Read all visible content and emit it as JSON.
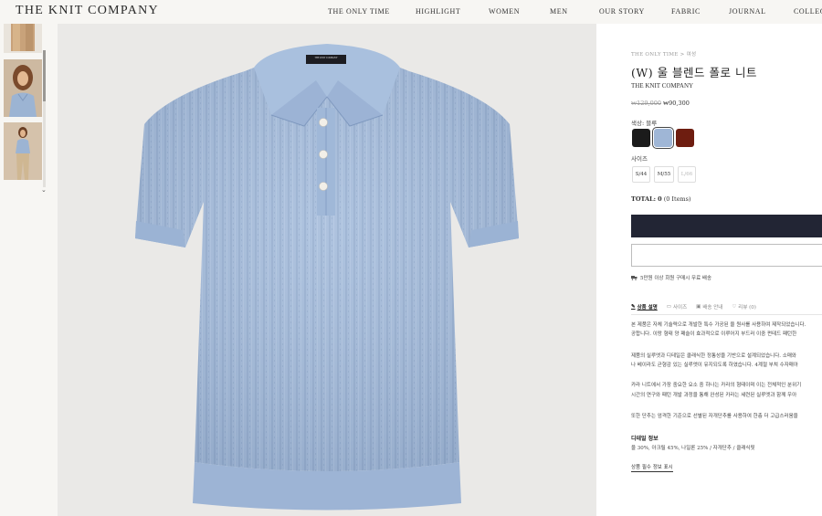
{
  "header": {
    "logo": "THE KNIT COMPANY",
    "nav": [
      "THE ONLY TIME",
      "HIGHLIGHT",
      "WOMEN",
      "MEN",
      "OUR STORY",
      "FABRIC",
      "JOURNAL",
      "COLLECTIONS"
    ]
  },
  "product": {
    "breadcrumb": "THE ONLY TIME > 여성",
    "title": "(W) 울 블렌드 폴로 니트",
    "brand": "THE KNIT COMPANY",
    "original_price": "₩129,000",
    "sale_price": "₩90,300",
    "color_label": "색상: 블루",
    "colors": [
      {
        "name": "black",
        "hex": "#1b1b1b"
      },
      {
        "name": "blue",
        "hex": "#9fb6d6"
      },
      {
        "name": "brown",
        "hex": "#6e1d10"
      }
    ],
    "size_label": "사이즈",
    "sizes": [
      "S/44",
      "M/55",
      "L/66"
    ],
    "total_label": "TOTAL:",
    "total_value": "0",
    "total_items": "(0 Items)",
    "shipping_note": "5만원 이상 회원 구매시 무료 배송",
    "tabs": [
      "상품 설명",
      "사이즈",
      "배송 안내",
      "리뷰 (0)"
    ],
    "description": [
      "본 제품은 자체 기술력으로 개발한 특수 가공된 울 원사를 사용하여 제작되었습니다.",
      "공합니다. 이랑 형태 양 패슬이 효과적으로 이루어지 부드러 이중 펀테드 패턴한",
      "제품의 실루엣과 디테일은 클래식한 정통성을 기반으로 설계되었습니다. 소매와",
      "나 베이라도 균형감 있는 실루엣이 유지되도록 하였습니다. 4계절 부쳐 수자매아",
      "카라 니트에서 가장 중요한 요소 중 하나는 카라의 형태이며 이는 전체적인 분위기",
      "시간의 연구와 패턴 개발 과정을 통해 완성된 카라는 세련된 실루엣과 함께 우아",
      "또한 단추는 엄격한 기준으로 선별된 자개단추를 사용하여 한층 더 고급스러움을"
    ],
    "detail_title": "디테일 정보",
    "detail_text": "울 30%, 아크릴 45%, 나일론 25% / 자개단추 / 클래식핏",
    "notice_link": "상품 필수 정보 표시",
    "label_tag": "THE KNIT COMPANY"
  }
}
